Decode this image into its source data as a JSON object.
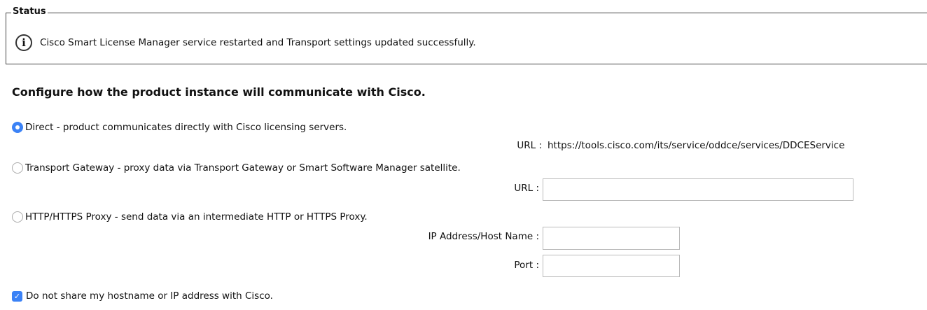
{
  "status": {
    "legend": "Status",
    "icon": "info-icon",
    "message": "Cisco Smart License Manager service restarted and Transport settings updated successfully."
  },
  "config": {
    "title": "Configure how the product instance will communicate with Cisco.",
    "options": [
      {
        "label": "Direct - product communicates directly with Cisco licensing servers.",
        "selected": true
      },
      {
        "label": "Transport Gateway - proxy data via Transport Gateway or Smart Software Manager satellite.",
        "selected": false
      },
      {
        "label": "HTTP/HTTPS Proxy - send data via an intermediate HTTP or HTTPS Proxy.",
        "selected": false
      }
    ],
    "direct_url_label": "URL :",
    "direct_url_value": "https://tools.cisco.com/its/service/oddce/services/DDCEService",
    "gateway_url_label": "URL :",
    "gateway_url_value": "",
    "proxy_host_label": "IP Address/Host Name :",
    "proxy_host_value": "",
    "proxy_port_label": "Port :",
    "proxy_port_value": "",
    "privacy_checkbox": {
      "label": "Do not share my hostname or IP address with Cisco.",
      "checked": true
    }
  },
  "colors": {
    "accent": "#3b82f6"
  }
}
